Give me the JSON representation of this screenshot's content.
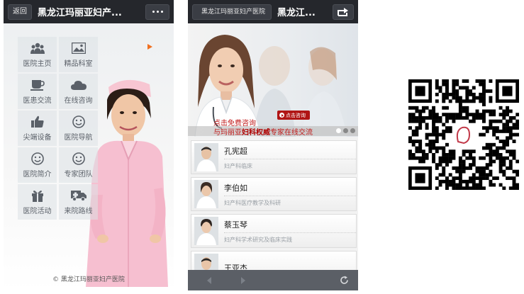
{
  "left_phone": {
    "back_label": "返回",
    "title": "黑龙江玛丽亚妇产...",
    "menu": [
      {
        "label": "医院主页",
        "icon": "people-icon"
      },
      {
        "label": "精品科室",
        "icon": "picture-icon"
      },
      {
        "label": "医患交流",
        "icon": "cup-icon"
      },
      {
        "label": "在线咨询",
        "icon": "cloud-icon"
      },
      {
        "label": "尖端设备",
        "icon": "thumbs-up-icon"
      },
      {
        "label": "医院导航",
        "icon": "smiley-icon"
      },
      {
        "label": "医院简介",
        "icon": "smiley-icon"
      },
      {
        "label": "专家团队",
        "icon": "smiley-icon"
      },
      {
        "label": "医院活动",
        "icon": "gift-icon"
      },
      {
        "label": "来院路线",
        "icon": "ambulance-icon"
      }
    ],
    "copyright": "© 黑龙江玛丽亚妇产医院"
  },
  "right_phone": {
    "url_label": "黑龙江玛丽亚妇产医院",
    "title": "黑龙江...",
    "banner": {
      "consult_button": "点击咨询",
      "free_link": "点击免费咨询",
      "strip_pre": "与玛丽亚",
      "strip_bold": "妇科权威",
      "strip_post": "专家在线交流"
    },
    "doctors": [
      {
        "name": "孔宪超",
        "title": "妇产科临床"
      },
      {
        "name": "李伯如",
        "title": "妇产科医疗教学及科研"
      },
      {
        "name": "蔡玉琴",
        "title": "妇产科学术研究及临床实践"
      },
      {
        "name": "王亚杰",
        "title": ""
      }
    ]
  },
  "colors": {
    "topbar": "#25272c",
    "accent_red": "#c01818",
    "arrow_orange": "#f07020",
    "bottombar": "#5b5f66"
  }
}
